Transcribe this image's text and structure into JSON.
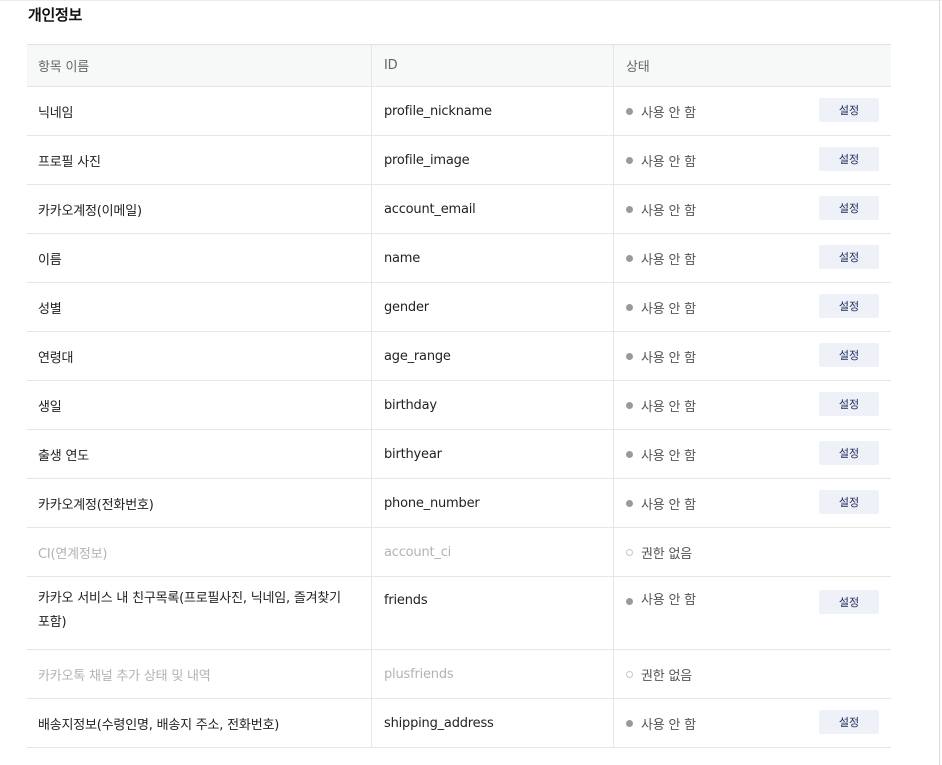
{
  "section_title": "개인정보",
  "columns": {
    "name": "항목 이름",
    "id": "ID",
    "status": "상태"
  },
  "rows": [
    {
      "name": "닉네임",
      "id": "profile_nickname",
      "status": "사용 안 함",
      "button": "설정"
    },
    {
      "name": "프로필 사진",
      "id": "profile_image",
      "status": "사용 안 함",
      "button": "설정"
    },
    {
      "name": "카카오계정(이메일)",
      "id": "account_email",
      "status": "사용 안 함",
      "button": "설정"
    },
    {
      "name": "이름",
      "id": "name",
      "status": "사용 안 함",
      "button": "설정"
    },
    {
      "name": "성별",
      "id": "gender",
      "status": "사용 안 함",
      "button": "설정"
    },
    {
      "name": "연령대",
      "id": "age_range",
      "status": "사용 안 함",
      "button": "설정"
    },
    {
      "name": "생일",
      "id": "birthday",
      "status": "사용 안 함",
      "button": "설정"
    },
    {
      "name": "출생 연도",
      "id": "birthyear",
      "status": "사용 안 함",
      "button": "설정"
    },
    {
      "name": "카카오계정(전화번호)",
      "id": "phone_number",
      "status": "사용 안 함",
      "button": "설정"
    },
    {
      "name": "CI(연계정보)",
      "id": "account_ci",
      "status": "권한 없음"
    },
    {
      "name": "카카오 서비스 내 친구목록(프로필사진, 닉네임, 즐겨찾기 포함)",
      "id": "friends",
      "status": "사용 안 함",
      "button": "설정"
    },
    {
      "name": "카카오톡 채널 추가 상태 및 내역",
      "id": "plusfriends",
      "status": "권한 없음"
    },
    {
      "name": "배송지정보(수령인명, 배송지 주소, 전화번호)",
      "id": "shipping_address",
      "status": "사용 안 함",
      "button": "설정"
    }
  ]
}
